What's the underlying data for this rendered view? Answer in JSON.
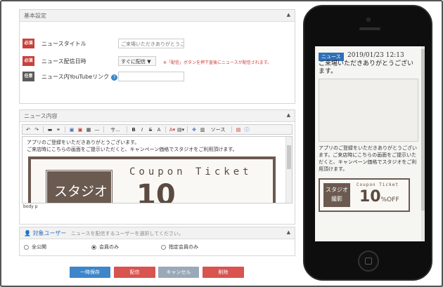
{
  "basic": {
    "header": "基本設定",
    "collapse": "▲",
    "rows": [
      {
        "badge": "必須",
        "label": "ニュースタイトル",
        "value": "ご来場いただきありがとうご"
      },
      {
        "badge": "必須",
        "label": "ニュース配信日時",
        "select": "すぐに配信 ▼",
        "note": "※「配信」ボタンを押下直後にニュースが配信されます。"
      },
      {
        "badge": "任意",
        "label": "ニュース内YouTubeリンク",
        "help": "?",
        "value": ""
      }
    ]
  },
  "content": {
    "header": "ニュース内容",
    "collapse": "▲",
    "toolbar": {
      "undo": "↶",
      "redo": "↷",
      "format": "サ...",
      "bold": "B",
      "italic": "I",
      "strike": "S",
      "clear": "A",
      "source": "ソース"
    },
    "editor_lines": [
      "アプリのご登録をいただきありがとうございます。",
      "ご来店時にこちらの画面をご提示いただくと、キャンペーン価格でスタジオをご利用頂けます。"
    ],
    "coupon_jp": "スタジオ",
    "coupon_title": "Coupon Ticket",
    "coupon_big": "10",
    "status": "body  p"
  },
  "target": {
    "header": "対象ユーザー",
    "sub": "ニュースを配信するユーザーを選択してください。",
    "collapse": "▲",
    "options": [
      {
        "label": "全公開",
        "selected": false
      },
      {
        "label": "会員のみ",
        "selected": true
      },
      {
        "label": "指定会員のみ",
        "selected": false
      }
    ]
  },
  "buttons": {
    "save": "一時保存",
    "publish": "配信",
    "cancel": "キャンセル",
    "delete": "削除"
  },
  "colors": {
    "save": "#3d86c9",
    "publish": "#d9534f",
    "cancel": "#9aa9b8",
    "delete": "#d9534f"
  },
  "phone": {
    "tag": "ニュース",
    "date": "2019/01/23 12:13",
    "title": "ご来場いただきありがとうございます。",
    "text": "アプリのご登録をいただきありがとうございます。ご来店時にこちらの画面をご提示いただくと、キャンペーン価格でスタジオをご利用頂けます。",
    "coupon_jp_1": "スタジオ",
    "coupon_jp_2": "撮影",
    "coupon_title": "Coupon Ticket",
    "coupon_big": "10",
    "coupon_off": "%OFF"
  }
}
